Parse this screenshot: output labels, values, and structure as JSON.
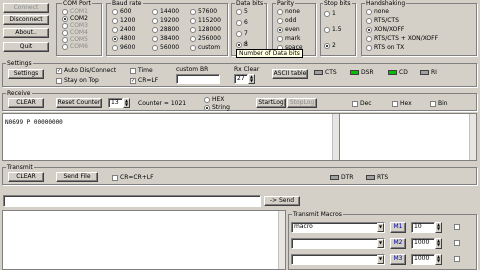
{
  "buttons": {
    "connect": "Connect",
    "disconnect": "Disconnect",
    "about": "About..",
    "quit": "Quit"
  },
  "com_port": {
    "title": "COM Port",
    "items": [
      "COM1",
      "COM2",
      "COM3",
      "COM4",
      "COM5",
      "COM6"
    ],
    "selected": "COM2"
  },
  "baud": {
    "title": "Baud rate",
    "col1": [
      "600",
      "1200",
      "2400",
      "4800",
      "9600"
    ],
    "col2": [
      "14400",
      "19200",
      "28800",
      "38400",
      "56000"
    ],
    "col3": [
      "57600",
      "115200",
      "128000",
      "256000",
      "custom"
    ],
    "selected": "4800"
  },
  "data_bits": {
    "title": "Data bits",
    "items": [
      "5",
      "6",
      "7",
      "8"
    ],
    "selected": "8"
  },
  "parity": {
    "title": "Parity",
    "items": [
      "none",
      "odd",
      "even",
      "mark",
      "space"
    ],
    "selected": "even"
  },
  "stop_bits": {
    "title": "Stop bits",
    "items": [
      "1",
      "1.5",
      "2"
    ],
    "selected": "2"
  },
  "handshaking": {
    "title": "Handshaking",
    "items": [
      "none",
      "RTS/CTS",
      "XON/XOFF",
      "RTS/CTS + XON/XOFF",
      "RTS on TX"
    ],
    "selected": "XON/XOFF"
  },
  "tooltip": "Number of Data bits",
  "settings": {
    "title": "Settings",
    "settings_btn": "Settings",
    "auto_dis_connect": "Auto Dis/Connect",
    "stay_on_top": "Stay on Top",
    "time": "Time",
    "cr_lf": "CR=LF",
    "custom_br_label": "custom BR",
    "rx_clear_label": "Rx Clear",
    "rx_clear_value": "27",
    "ascii_table": "ASCII table",
    "cts": "CTS",
    "dsr": "DSR",
    "cd": "CD",
    "ri": "RI"
  },
  "receive": {
    "title": "Receive",
    "clear": "CLEAR",
    "reset_counter": "Reset Counter",
    "counter_value": "13",
    "counter_text": "Counter = 1021",
    "hex": "HEX",
    "string": "String",
    "startlog": "StartLog",
    "stoplog": "StopLog",
    "dec": "Dec",
    "hex_chk": "Hex",
    "bin": "Bin",
    "text": "N0699 P 00000000"
  },
  "transmit": {
    "title": "Transmit",
    "clear": "CLEAR",
    "send_file": "Send File",
    "cr_crlf": "CR=CR+LF",
    "dtr": "DTR",
    "rts": "RTS",
    "send": "-> Send",
    "macros_title": "Transmit Macros",
    "macros": [
      {
        "name": "macro",
        "key": "M1",
        "value": "10"
      },
      {
        "name": "",
        "key": "M2",
        "value": "1000"
      },
      {
        "name": "",
        "key": "M3",
        "value": "1000"
      }
    ]
  },
  "colors": {
    "led_green": "#00c000",
    "led_gray": "#a0a0a0",
    "button_face": "#d4d0c8"
  }
}
